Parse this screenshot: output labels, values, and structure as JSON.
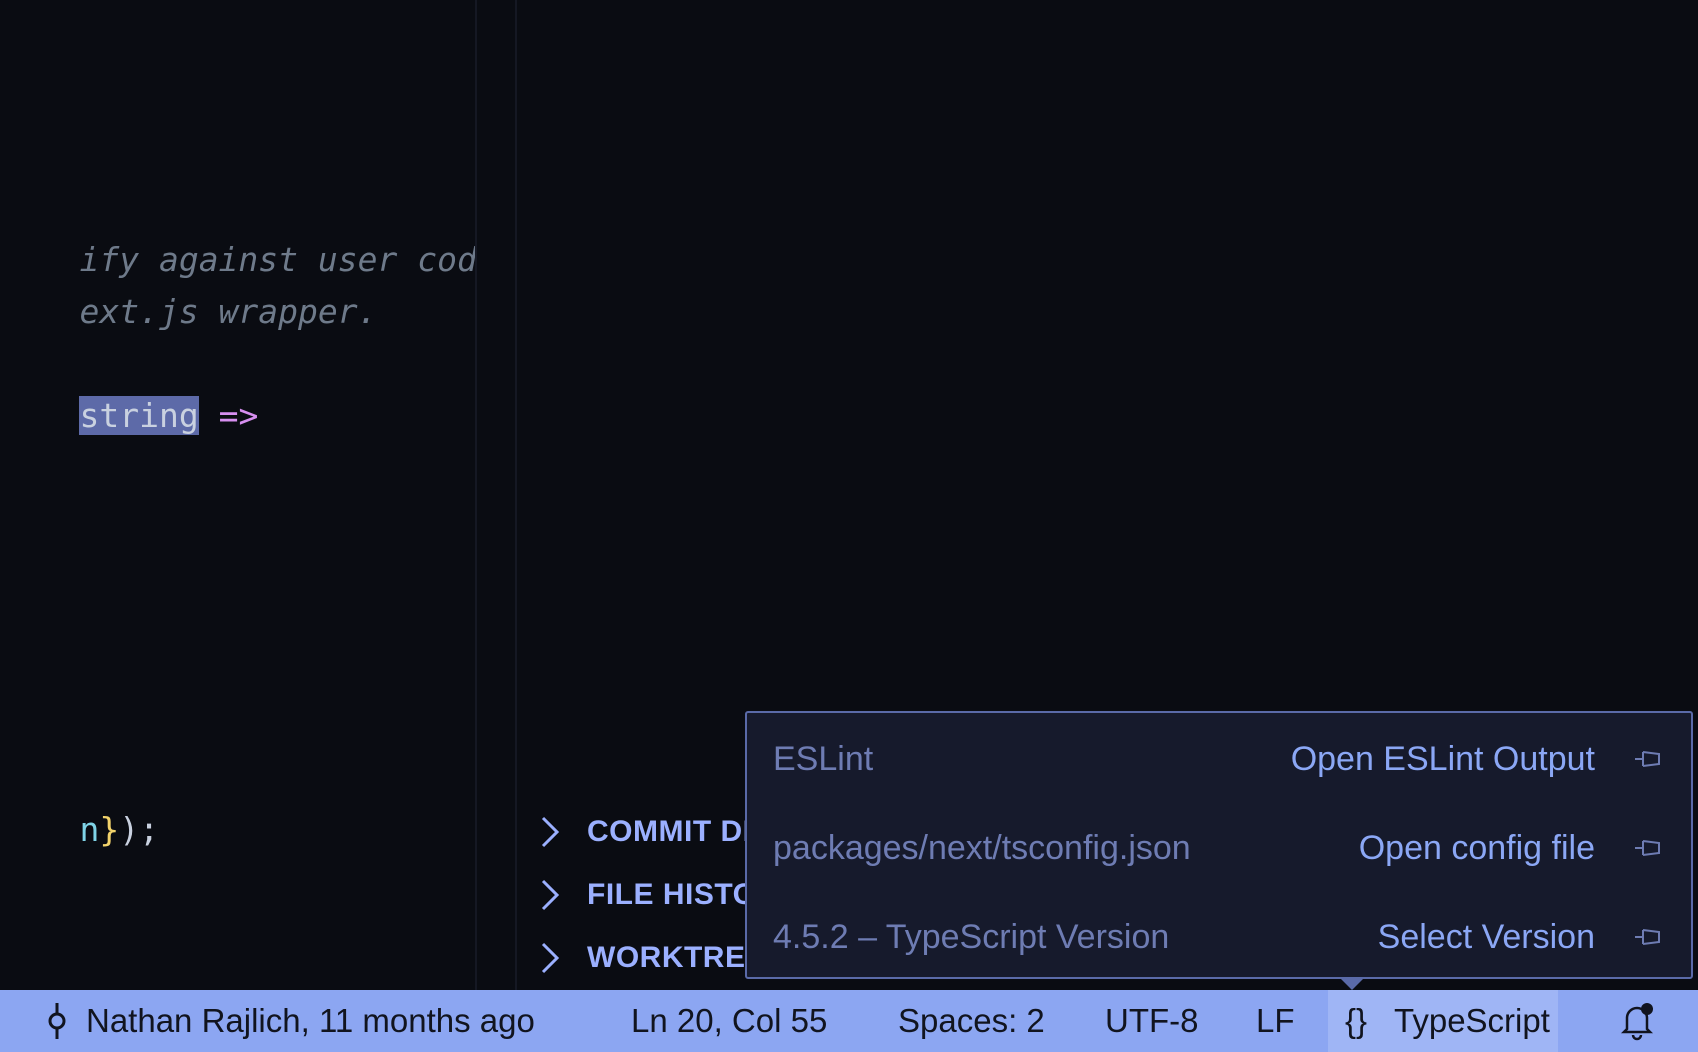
{
  "editor": {
    "lines": [
      {
        "parts": [
          {
            "text": "ify against user code.",
            "cls": "comment"
          }
        ]
      },
      {
        "parts": [
          {
            "text": "ext.js wrapper.",
            "cls": "comment"
          }
        ]
      },
      {
        "parts": [
          {
            "text": "string",
            "cls": "kw-type"
          },
          {
            "text": " =>",
            "cls": "arrow"
          }
        ]
      },
      {
        "parts": [
          {
            "text": "n",
            "cls": "ident"
          },
          {
            "text": "}",
            "cls": "brace"
          },
          {
            "text": ");",
            "cls": "punct"
          }
        ]
      }
    ]
  },
  "side_panel": {
    "sections": [
      {
        "label": "COMMIT DETAILS"
      },
      {
        "label": "FILE HISTORY"
      },
      {
        "label": "WORKTREES"
      }
    ]
  },
  "popup": {
    "rows": [
      {
        "label": "ESLint",
        "action": "Open ESLint Output"
      },
      {
        "label": "packages/next/tsconfig.json",
        "action": "Open config file"
      },
      {
        "label": "4.5.2 – TypeScript Version",
        "action": "Select Version"
      }
    ]
  },
  "statusbar": {
    "git_blame": "Nathan Rajlich, 11 months ago",
    "cursor_position": "Ln 20, Col 55",
    "indentation": "Spaces: 2",
    "encoding": "UTF-8",
    "eol": "LF",
    "language_status_icon": "{}",
    "language": "TypeScript"
  },
  "colors": {
    "statusbar_bg": "#8ca6f2",
    "popup_bg": "#161a2c",
    "popup_border": "#5a6aa8",
    "accent": "#9bb0ff"
  }
}
